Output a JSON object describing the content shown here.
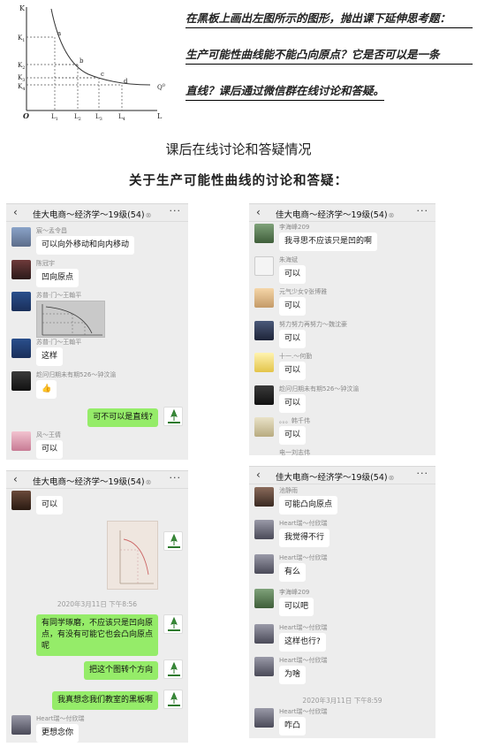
{
  "graph": {
    "y_axis": "K",
    "x_axis": "L",
    "origin": "O",
    "curve_label": "Q",
    "points": [
      "a",
      "b",
      "c",
      "d"
    ],
    "k_ticks": [
      "K",
      "K",
      "K",
      "K"
    ],
    "k_subs": [
      "1",
      "2",
      "3",
      "4"
    ],
    "l_ticks": [
      "L",
      "L",
      "L",
      "L"
    ],
    "l_subs": [
      "1",
      "2",
      "3",
      "4"
    ],
    "q_sup": "0"
  },
  "note": {
    "line1": "在黑板上画出左图所示的图形，抛出课下延伸思考题：",
    "line2": "生产可能性曲线能不能凸向原点？它是否可以是一条",
    "line3": "直线？课后通过微信群在线讨论和答疑。"
  },
  "heading": "课后在线讨论和答疑情况",
  "subheading": "关于生产可能性曲线的讨论和答疑：",
  "colors": {
    "out_bubble": "#95ec69",
    "in_bubble": "#ffffff",
    "chat_bg": "#ededed"
  },
  "group_title": "佳大电商～经济学～19级(54)",
  "icons": {
    "back": "‹",
    "more": "···",
    "mute": "⊗"
  },
  "panels": [
    {
      "messages": [
        {
          "dir": "in",
          "sender": "宸～孟令昌",
          "text": "可以向外移动和向内移动"
        },
        {
          "dir": "in",
          "sender": "陈冠宇",
          "text": "凹向原点"
        },
        {
          "dir": "in",
          "sender": "苏普·门～王翰平",
          "image": "graph-photo"
        },
        {
          "dir": "in",
          "sender": "苏普·门～王翰平",
          "text": "这样"
        },
        {
          "dir": "in",
          "sender": "趁问归期未有期526～钟汶渝",
          "text": "👍"
        },
        {
          "dir": "out",
          "text": "可不可以是直线?"
        },
        {
          "dir": "in",
          "sender": "风～王倩",
          "text": "可以"
        }
      ]
    },
    {
      "messages": [
        {
          "dir": "in",
          "sender": "李海峰209",
          "text": "我寻思不应该只是凹的啊"
        },
        {
          "dir": "in",
          "sender": "朱海斌",
          "text": "可以"
        },
        {
          "dir": "in",
          "sender": "元气少女♀张博雅",
          "text": "可以"
        },
        {
          "dir": "in",
          "sender": "努力努力再努力～魏沈豪",
          "text": "可以"
        },
        {
          "dir": "in",
          "sender": "十一.～何勤",
          "text": "可以"
        },
        {
          "dir": "in",
          "sender": "趁问归期未有期526～钟汶渝",
          "text": "可以"
        },
        {
          "dir": "in",
          "sender": "。。。韩千伟",
          "text": "可以"
        },
        {
          "dir": "in",
          "sender": "电一刘志伟",
          "text": ""
        }
      ]
    },
    {
      "messages": [
        {
          "dir": "in",
          "sender": "",
          "text": "可以"
        },
        {
          "dir": "out",
          "image": "blackboard-photo"
        },
        {
          "timestamp": "2020年3月11日 下午8:56"
        },
        {
          "dir": "out",
          "text": "有同学琢磨，不应该只是凹向原点，有没有可能它也会凸向原点呢"
        },
        {
          "dir": "out",
          "text": "把这个图转个方向"
        },
        {
          "dir": "out",
          "text": "我真想念我们教室的黑板啊"
        },
        {
          "dir": "in",
          "sender": "Heart瑞～付欣瑞",
          "text": "更想念你"
        }
      ]
    },
    {
      "messages": [
        {
          "dir": "in",
          "sender": "池静雨",
          "text": "可能凸向原点"
        },
        {
          "dir": "in",
          "sender": "Heart瑞～付欣瑞",
          "text": "我觉得不行"
        },
        {
          "dir": "in",
          "sender": "Heart瑞～付欣瑞",
          "text": "有么"
        },
        {
          "dir": "in",
          "sender": "李海峰209",
          "text": "可以吧"
        },
        {
          "dir": "in",
          "sender": "Heart瑞～付欣瑞",
          "text": "这样也行?"
        },
        {
          "dir": "in",
          "sender": "Heart瑞～付欣瑞",
          "text": "为啥"
        },
        {
          "timestamp": "2020年3月11日 下午8:59"
        },
        {
          "dir": "in",
          "sender": "Heart瑞～付欣瑞",
          "text": "咋凸"
        }
      ]
    }
  ]
}
